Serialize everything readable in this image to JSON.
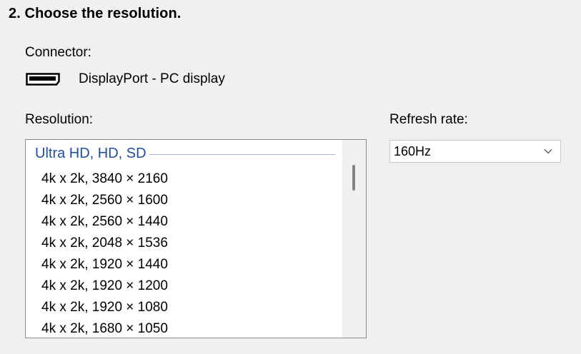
{
  "section": {
    "title": "2. Choose the resolution."
  },
  "connector": {
    "label": "Connector:",
    "icon": "displayport-icon",
    "name": "DisplayPort - PC display"
  },
  "resolution": {
    "label": "Resolution:",
    "group": "Ultra HD, HD, SD",
    "items": [
      "4k x 2k, 3840 × 2160",
      "4k x 2k, 2560 × 1600",
      "4k x 2k, 2560 × 1440",
      "4k x 2k, 2048 × 1536",
      "4k x 2k, 1920 × 1440",
      "4k x 2k, 1920 × 1200",
      "4k x 2k, 1920 × 1080",
      "4k x 2k, 1680 × 1050"
    ]
  },
  "refresh": {
    "label": "Refresh rate:",
    "value": "160Hz"
  },
  "colors": {
    "background": "#f0f0f0",
    "group_header": "#1f4e9e",
    "list_border": "#8a8a8a"
  }
}
